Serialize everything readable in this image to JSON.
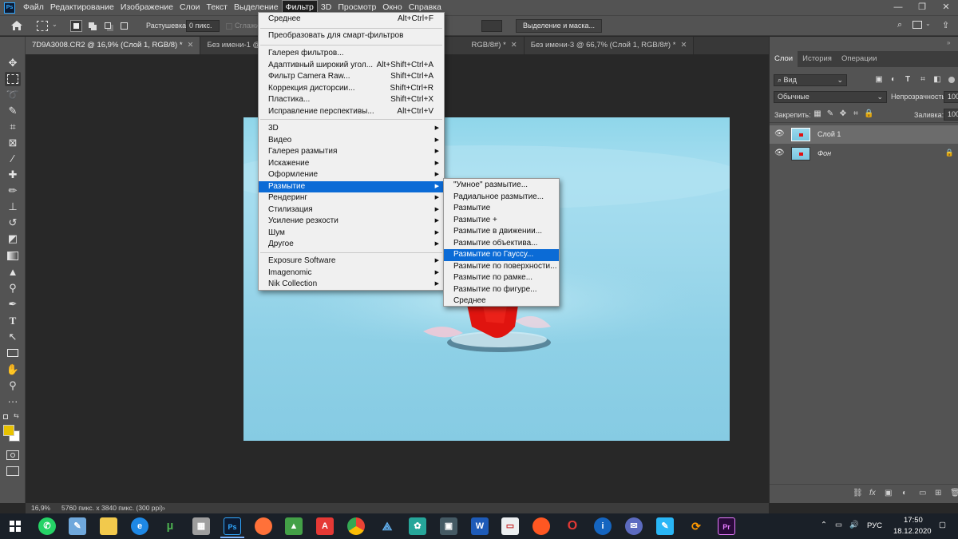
{
  "menubar": {
    "items": [
      "Файл",
      "Редактирование",
      "Изображение",
      "Слои",
      "Текст",
      "Выделение",
      "Фильтр",
      "3D",
      "Просмотр",
      "Окно",
      "Справка"
    ],
    "active": "Фильтр",
    "logo": "Ps"
  },
  "options": {
    "feather_label": "Растушевка:",
    "feather_value": "0 пикс.",
    "antialias_label": "Сглажив.",
    "select_mask_button": "Выделение и маска..."
  },
  "tabs": [
    {
      "label": "7D9A3008.CR2 @ 16,9% (Слой 1, RGB/8) *",
      "active": true
    },
    {
      "label": "Без имени-1 @ 66,7",
      "active": false
    },
    {
      "label": "RGB/8#) *",
      "active": false
    },
    {
      "label": "Без имени-3 @ 66,7% (Слой 1, RGB/8#) *",
      "active": false
    }
  ],
  "filter_menu": {
    "top_items": [
      {
        "label": "Среднее",
        "shortcut": "Alt+Ctrl+F"
      }
    ],
    "smart": "Преобразовать для смарт-фильтров",
    "gallery_items": [
      {
        "label": "Галерея фильтров...",
        "shortcut": ""
      },
      {
        "label": "Адаптивный широкий угол...",
        "shortcut": "Alt+Shift+Ctrl+A"
      },
      {
        "label": "Фильтр Camera Raw...",
        "shortcut": "Shift+Ctrl+A"
      },
      {
        "label": "Коррекция дисторсии...",
        "shortcut": "Shift+Ctrl+R"
      },
      {
        "label": "Пластика...",
        "shortcut": "Shift+Ctrl+X"
      },
      {
        "label": "Исправление перспективы...",
        "shortcut": "Alt+Ctrl+V"
      }
    ],
    "submenus": [
      "3D",
      "Видео",
      "Галерея размытия",
      "Искажение",
      "Оформление",
      "Размытие",
      "Рендеринг",
      "Стилизация",
      "Усиление резкости",
      "Шум",
      "Другое"
    ],
    "highlighted": "Размытие",
    "plugins": [
      "Exposure Software",
      "Imagenomic",
      "Nik Collection"
    ]
  },
  "blur_menu": {
    "items": [
      "\"Умное\" размытие...",
      "Радиальное размытие...",
      "Размытие",
      "Размытие +",
      "Размытие в движении...",
      "Размытие объектива...",
      "Размытие по Гауссу...",
      "Размытие по поверхности...",
      "Размытие по рамке...",
      "Размытие по фигуре...",
      "Среднее"
    ],
    "highlighted": "Размытие по Гауссу..."
  },
  "layers_panel": {
    "tabs": [
      "Слои",
      "История",
      "Операции"
    ],
    "active_tab": "Слои",
    "filter_kind": "Вид",
    "blend_mode": "Обычные",
    "opacity_label": "Непрозрачность:",
    "opacity_value": "100%",
    "lock_label": "Закрепить:",
    "fill_label": "Заливка:",
    "fill_value": "100%",
    "layers": [
      {
        "name": "Слой 1",
        "selected": true,
        "locked": false,
        "italic": false
      },
      {
        "name": "Фон",
        "selected": false,
        "locked": true,
        "italic": true
      }
    ]
  },
  "status": {
    "zoom": "16,9%",
    "doc_info": "5760 пикс. x 3840 пикс. (300 ppi)"
  },
  "taskbar": {
    "lang": "РУС",
    "time": "17:50",
    "date": "18.12.2020",
    "apps": [
      "whatsapp",
      "notes",
      "file-explorer",
      "edge",
      "utorrent",
      "calculator",
      "photoshop",
      "firefox",
      "app-green",
      "acrobat",
      "chrome",
      "network",
      "paint",
      "save",
      "word",
      "slides",
      "firefox-dev",
      "opera",
      "app-info",
      "chat",
      "notepad",
      "app-arrow",
      "premiere"
    ]
  },
  "colors": {
    "highlight": "#0b6bd6",
    "ui_bg": "#535353",
    "canvas_blue": "#8fd6ea",
    "foreground_swatch": "#e8c200"
  }
}
